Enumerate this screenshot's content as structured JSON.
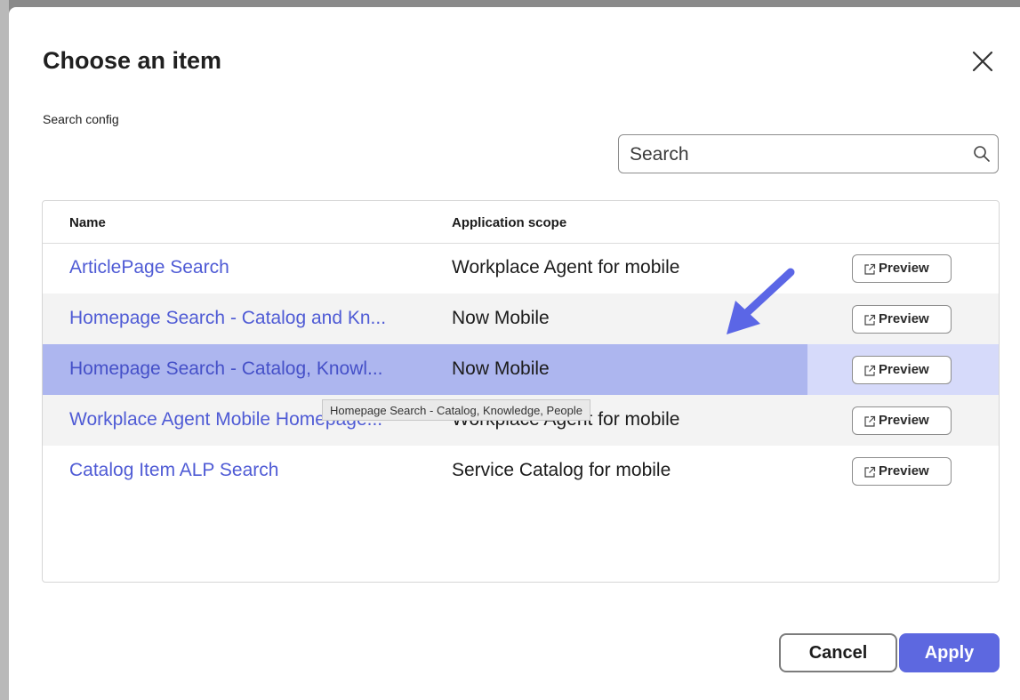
{
  "dialog": {
    "title": "Choose an item",
    "subtitle": "Search config"
  },
  "search": {
    "placeholder": "Search",
    "value": ""
  },
  "table": {
    "headers": {
      "name": "Name",
      "scope": "Application scope"
    },
    "rows": [
      {
        "name": "ArticlePage Search",
        "scope": "Workplace Agent for mobile",
        "preview": "Preview",
        "state": "normal"
      },
      {
        "name": "Homepage Search - Catalog and Kn...",
        "scope": "Now Mobile",
        "preview": "Preview",
        "state": "alt"
      },
      {
        "name": "Homepage Search - Catalog, Knowl...",
        "scope": "Now Mobile",
        "preview": "Preview",
        "state": "selected"
      },
      {
        "name": "Workplace Agent Mobile Homepage...",
        "scope": "Workplace Agent for mobile",
        "preview": "Preview",
        "state": "alt"
      },
      {
        "name": "Catalog Item ALP Search",
        "scope": "Service Catalog for mobile",
        "preview": "Preview",
        "state": "normal"
      }
    ]
  },
  "tooltip": "Homepage Search - Catalog, Knowledge, People",
  "footer": {
    "cancel": "Cancel",
    "apply": "Apply"
  },
  "colors": {
    "accent": "#5d68e0",
    "link": "#4f5bd5",
    "selected_row": "#adb6ef",
    "annotation_arrow": "#5b66e6"
  },
  "icons": {
    "close": "close-icon",
    "search": "search-icon",
    "preview": "external-link-icon",
    "annotation": "arrow-annotation-icon"
  }
}
